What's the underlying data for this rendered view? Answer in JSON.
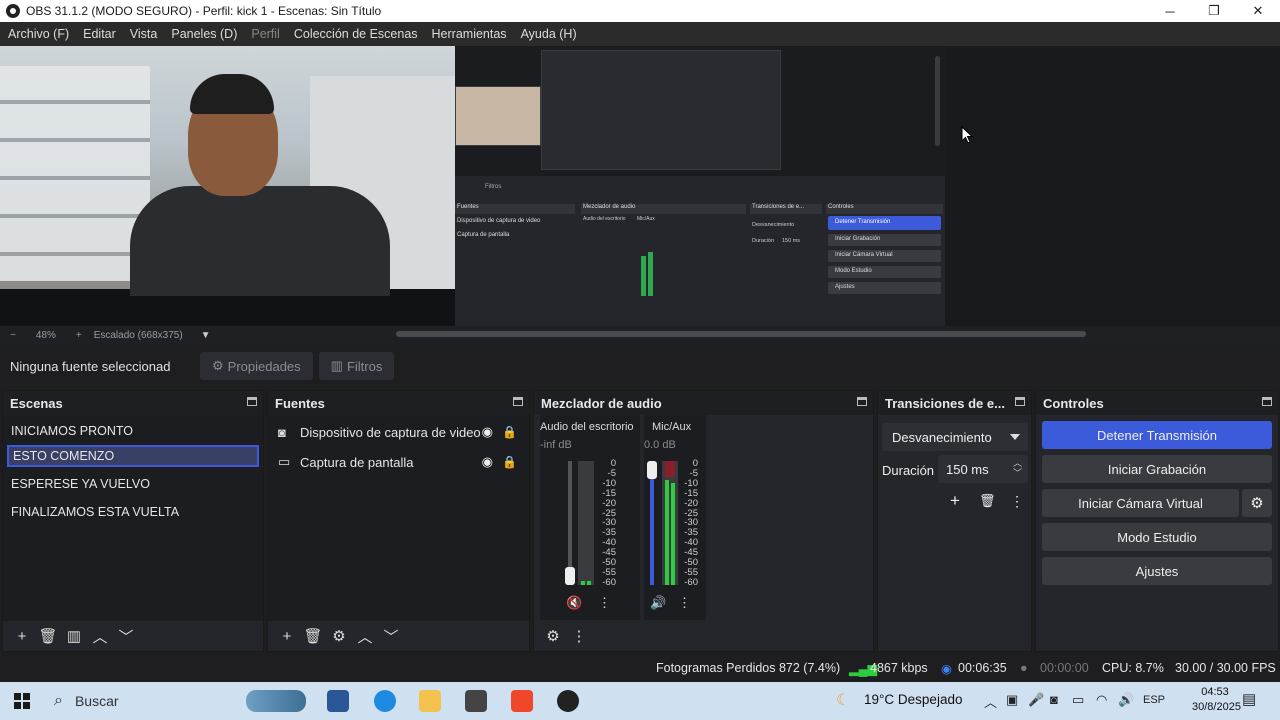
{
  "window": {
    "title": "OBS 31.1.2 (MODO SEGURO) - Perfil: kick 1 - Escenas: Sin Título",
    "controls": [
      "─",
      "❐",
      "✕"
    ]
  },
  "menu": [
    "Archivo (F)",
    "Editar",
    "Vista",
    "Paneles (D)",
    "Perfil",
    "Colección de Escenas",
    "Herramientas",
    "Ayuda (H)"
  ],
  "preview": {
    "zoom": "48%",
    "scaling": "Escalado (668x375)",
    "nested": {
      "sources_title": "Fuentes",
      "filters_label": "Filtros",
      "mixer_title": "Mezclador de audio",
      "transitions_title": "Transiciones de e...",
      "controls_title": "Controles",
      "src1": "Dispositivo de captura de video",
      "src2": "Captura de pantalla",
      "ch1": "Audio del escritorio",
      "ch2": "Mic/Aux",
      "fade": "Desvanecimiento",
      "dur_label": "Duración",
      "dur": "150 ms",
      "btns": [
        "Detener Transmisión",
        "Iniciar Grabación",
        "Iniciar Cámara Virtual",
        "Modo Estudio",
        "Ajustes"
      ]
    }
  },
  "source_toolbar": {
    "no_selection": "Ninguna fuente seleccionada",
    "properties": "Propiedades",
    "filters": "Filtros"
  },
  "scenes": {
    "title": "Escenas",
    "items": [
      "INICIAMOS PRONTO",
      "ESTO COMENZO",
      "ESPERESE YA VUELVO",
      "FINALIZAMOS ESTA VUELTA"
    ],
    "selected_index": 1
  },
  "sources": {
    "title": "Fuentes",
    "items": [
      {
        "label": "Dispositivo de captura de video",
        "icon": "camera-icon"
      },
      {
        "label": "Captura de pantalla",
        "icon": "monitor-icon"
      }
    ]
  },
  "mixer": {
    "title": "Mezclador de audio",
    "channels": [
      {
        "name": "Audio del escritorio",
        "db": "-inf dB",
        "level": 0.03
      },
      {
        "name": "Mic/Aux",
        "db": "0.0 dB",
        "level": 0.85
      }
    ],
    "scale": [
      "0",
      "-5",
      "-10",
      "-15",
      "-20",
      "-25",
      "-30",
      "-35",
      "-40",
      "-45",
      "-50",
      "-55",
      "-60"
    ]
  },
  "transitions": {
    "title": "Transiciones de e...",
    "selected": "Desvanecimiento",
    "duration_label": "Duración",
    "duration": "150 ms"
  },
  "controls": {
    "title": "Controles",
    "stop_stream": "Detener Transmisión",
    "start_recording": "Iniciar Grabación",
    "start_virtual_cam": "Iniciar Cámara Virtual",
    "studio_mode": "Modo Estudio",
    "settings": "Ajustes",
    "accent": "#3b5bdb"
  },
  "status": {
    "dropped_frames": "Fotogramas Perdidos 872 (7.4%)",
    "bitrate": "4867 kbps",
    "stream_time": "00:06:35",
    "rec_time": "00:00:00",
    "cpu": "CPU: 8.7%",
    "fps": "30.00 / 30.00 FPS"
  },
  "taskbar": {
    "search": "Buscar",
    "weather": "19°C  Despejado",
    "lang": "ESP",
    "time": "04:53",
    "date": "30/8/2025"
  }
}
